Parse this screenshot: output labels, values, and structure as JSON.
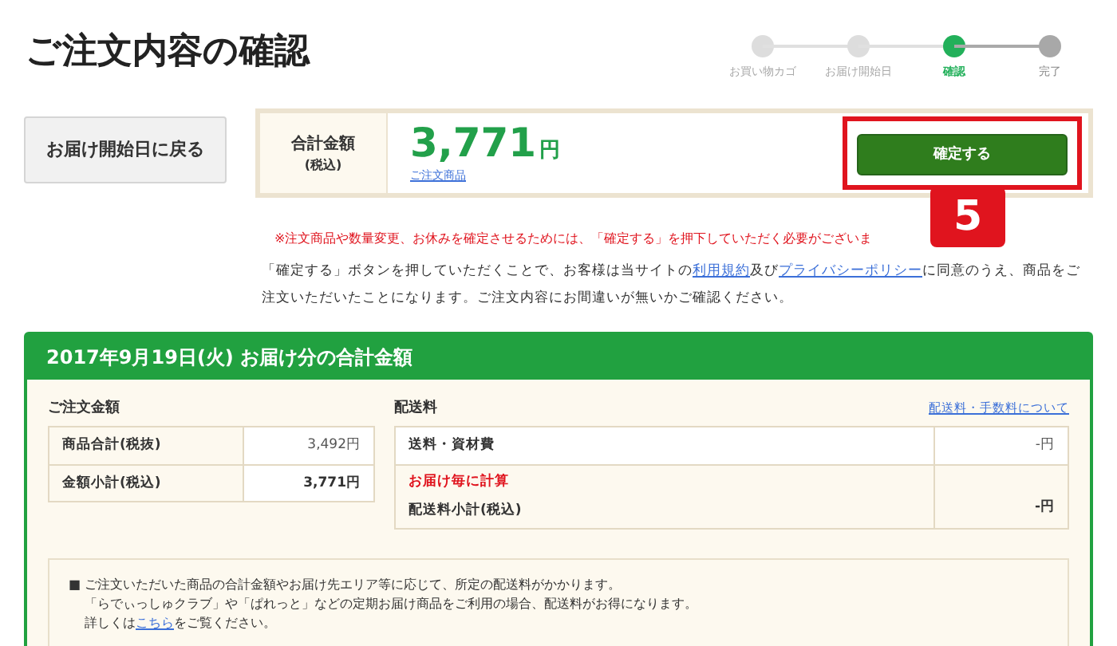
{
  "page_title": "ご注文内容の確認",
  "steps": [
    {
      "label": "お買い物カゴ",
      "done": true,
      "selected": false
    },
    {
      "label": "お届け開始日",
      "done": true,
      "selected": false
    },
    {
      "label": "確認",
      "done": false,
      "selected": true
    },
    {
      "label": "完了",
      "done": false,
      "selected": false
    }
  ],
  "back_button": "お届け開始日に戻る",
  "total": {
    "label": "合計金額",
    "sublabel": "(税込)",
    "amount": "3,771",
    "unit": "円",
    "link": "ご注文商品",
    "confirm_button": "確定する",
    "highlighted": true
  },
  "annotation_badge": "5",
  "notes": {
    "warning": "※注文商品や数量変更、お休みを確定させるためには、「確定する」を押下していただく必要がございま",
    "agreement": [
      {
        "kind": "text",
        "text": "「確定する」ボタンを押していただくことで、お客様は当サイトの"
      },
      {
        "kind": "link",
        "text": "利用規約"
      },
      {
        "kind": "text",
        "text": "及び"
      },
      {
        "kind": "link",
        "text": "プライバシーポリシー"
      },
      {
        "kind": "text",
        "text": "に同意のうえ、商品をご注文いただいたことになります。ご注文内容にお間違いが無いかご確認ください。"
      }
    ]
  },
  "delivery": {
    "title": "2017年9月19日(火) お届け分の合計金額",
    "order_amount": {
      "heading": "ご注文金額",
      "rows": [
        {
          "label": "商品合計(税抜)",
          "value": "3,492円",
          "bold": false
        },
        {
          "label": "金額小計(税込)",
          "value": "3,771円",
          "bold": true
        }
      ]
    },
    "shipping": {
      "heading": "配送料",
      "link": "配送料・手数料について",
      "rows": [
        {
          "label": "送料・資材費",
          "value": "-円",
          "bold": false
        },
        {
          "label": "配送料小計(税込)",
          "note": "お届け毎に計算",
          "value": "-円",
          "bold": true
        }
      ]
    },
    "info": [
      {
        "kind": "text",
        "text": "■ ご注文いただいた商品の合計金額やお届け先エリア等に応じて、所定の配送料がかかります。"
      },
      {
        "kind": "text",
        "text": "「らでぃっしゅクラブ」や「ぱれっと」などの定期お届け商品をご利用の場合、配送料がお得になります。"
      },
      {
        "kind": "linkline",
        "before": "詳しくは",
        "link": "こちら",
        "after": "をご覧ください。"
      }
    ]
  }
}
